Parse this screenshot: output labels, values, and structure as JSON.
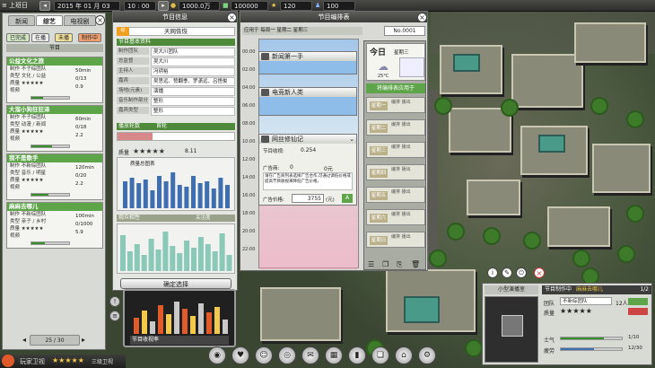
{
  "topbar": {
    "menu_label": "上班日",
    "date": "2015 年 01 月 03 日",
    "time": "10 : 00",
    "money": "1000.0万元",
    "resource_a": "100000",
    "resource_b": "120",
    "resource_c": "100"
  },
  "left_panel": {
    "tabs": [
      "新闻",
      "综艺",
      "电视剧"
    ],
    "filters": [
      "已完成",
      "在播",
      "未播",
      "制作中"
    ],
    "header": "节目",
    "programs": [
      {
        "title": "公益文化之旅",
        "rows": [
          "制作 不子综团队",
          "类型 文化 / 公益",
          "质量 ★★★★★",
          "视频"
        ],
        "time": "50min",
        "ratio1": "0/13",
        "ratio2": "0.9",
        "progress": 0.3
      },
      {
        "title": "大溜小狗狂狂泽",
        "rows": [
          "制作 不子综团队",
          "类型 动漫 / 新闻",
          "质量 ★★★★★",
          "视频"
        ],
        "time": "60min",
        "ratio1": "0/18",
        "ratio2": "2.2",
        "progress": 0.55
      },
      {
        "title": "我不是歌手",
        "rows": [
          "制作 不新综团队",
          "类型 音乐 / 明星",
          "质量 ★★★★★",
          "视频"
        ],
        "time": "120min",
        "ratio1": "0/20",
        "ratio2": "2.2",
        "progress": 0.45
      },
      {
        "title": "麻麻去哪儿",
        "rows": [
          "制作 不新综团队",
          "类型 亲子 / 乡村",
          "质量 ★★★★★",
          "视频"
        ],
        "time": "100min",
        "ratio1": "0/1000",
        "ratio2": "5.9",
        "progress": 0.35
      }
    ],
    "pager": "25 / 30"
  },
  "info_panel": {
    "title": "节目信息",
    "program_name": "天网恢恢",
    "basic_section": "节目基本资料",
    "fields": [
      {
        "k": "制作团队",
        "v": "吴大川团队"
      },
      {
        "k": "总监督",
        "v": "吴大川"
      },
      {
        "k": "主持人",
        "v": "冯玥裕"
      },
      {
        "k": "嘉宾",
        "v": "吴思远、赞翻季、罗潇远、吕悟俊"
      },
      {
        "k": "场地(元素)",
        "v": "演播"
      },
      {
        "k": "音乐制作部分",
        "v": "整形"
      },
      {
        "k": "嘉宾类型",
        "v": "整形"
      }
    ],
    "rating_section": "播放轮数",
    "rating_label": "首轮",
    "quality_label": "质量",
    "quality_stars": "★★★★★",
    "quality_value": "8.11",
    "curve_label": "质量总图表",
    "chart_section": "观众相性",
    "chart_note": "关注度",
    "confirm": "确定选择"
  },
  "sched_panel": {
    "title": "节目编排表",
    "subtitle": "应用于 每周一 星期二 星期三",
    "number": "No.0001",
    "slots": [
      {
        "name": "新闻第一手"
      },
      {
        "name": "电竞新人类"
      },
      {
        "name": "网丝修仙记"
      }
    ],
    "detail": {
      "revenue_label": "节目收视:",
      "revenue_value": "0.254",
      "ad_label": "广告商:",
      "ad_count": "0",
      "ad_money": "0元",
      "desc": "请在广告商列表选择广告合作,可通过调低价格或提高节目收视来降低广告价格。",
      "price_label": "广告价格:",
      "price_value": "3755",
      "price_unit": "(元)"
    },
    "times": [
      "00:00",
      "02:00",
      "04:00",
      "06:00",
      "08:00",
      "10:00",
      "12:00",
      "14:00",
      "16:00",
      "18:00",
      "20:00",
      "22:00"
    ],
    "today": {
      "label": "今日",
      "weekday": "星期三",
      "weather_label": "天气",
      "temp": "25°C"
    },
    "apply_button": "将编排表应用于",
    "days": [
      {
        "label": "星期一",
        "info": "编排 播出"
      },
      {
        "label": "星期二",
        "info": "编排 播出"
      },
      {
        "label": "星期三",
        "info": "编排 播出"
      },
      {
        "label": "星期四",
        "info": "编排 播出"
      },
      {
        "label": "星期五",
        "info": "编排 播出"
      },
      {
        "label": "星期六",
        "info": "编排 播出"
      },
      {
        "label": "星期日",
        "info": "编排 播出"
      }
    ]
  },
  "studio": {
    "title": "小型演播室",
    "status": "节目制作中",
    "program": "麻麻去哪儿",
    "count": "1/2",
    "team_label": "团队",
    "team_value": "不新综团队",
    "staff": "12人",
    "quality_label": "质量",
    "quality_stars": "★★★★★",
    "morale_label": "士气",
    "fatigue_label": "疲劳",
    "morale_value": "1/10",
    "fatigue_value": "12/30",
    "morale": 0.7,
    "fatigue": 0.55
  },
  "ratings_widget": {
    "label": "节目收视率",
    "value": "排名"
  },
  "bottombar": {
    "channel": "玩家卫视",
    "stars": "★★★★★",
    "level": "三级卫视"
  },
  "colors": {
    "accent_green": "#5ea54a",
    "panel_bg": "#e4e6e2",
    "bar_blue": "#3f6fb0"
  }
}
